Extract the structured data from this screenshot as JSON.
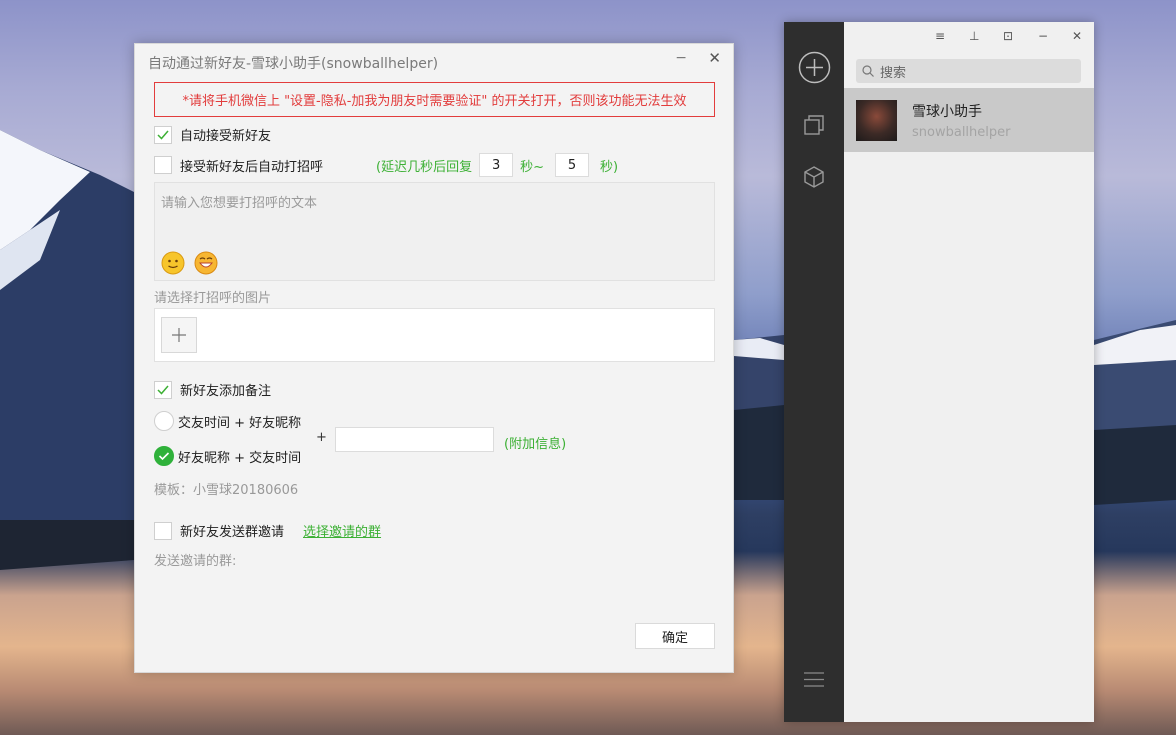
{
  "dialog": {
    "title": "自动通过新好友-雪球小助手(snowballhelper)",
    "min": "−",
    "close": "✕",
    "warning": "*请将手机微信上 \"设置-隐私-加我为朋友时需要验证\" 的开关打开，否则该功能无法生效",
    "auto_accept": {
      "label": "自动接受新好友",
      "checked": true
    },
    "auto_greet": {
      "label": "接受新好友后自动打招呼",
      "checked": false
    },
    "delay": {
      "prefix": "(延迟几秒后回复",
      "min": "3",
      "mid": "秒~",
      "max": "5",
      "suffix": "秒)"
    },
    "greet_placeholder": "请输入您想要打招呼的文本",
    "image_label": "请选择打招呼的图片",
    "add_remark": {
      "label": "新好友添加备注",
      "checked": true
    },
    "radio1": {
      "label": "交友时间 + 好友昵称",
      "selected": false
    },
    "radio2": {
      "label": "好友昵称 + 交友时间",
      "selected": true
    },
    "plus": "+",
    "extra_info": "(附加信息)",
    "template": "模板：小雪球20180606",
    "group_invite": {
      "label": "新好友发送群邀请",
      "checked": false
    },
    "choose_group": "选择邀请的群",
    "send_groups": "发送邀请的群:",
    "ok": "确定"
  },
  "wechat": {
    "controls": [
      "≡",
      "⊥",
      "⊡",
      "−",
      "✕"
    ],
    "search_placeholder": "搜索",
    "chat": {
      "name": "雪球小助手",
      "sub": "snowballhelper"
    }
  }
}
